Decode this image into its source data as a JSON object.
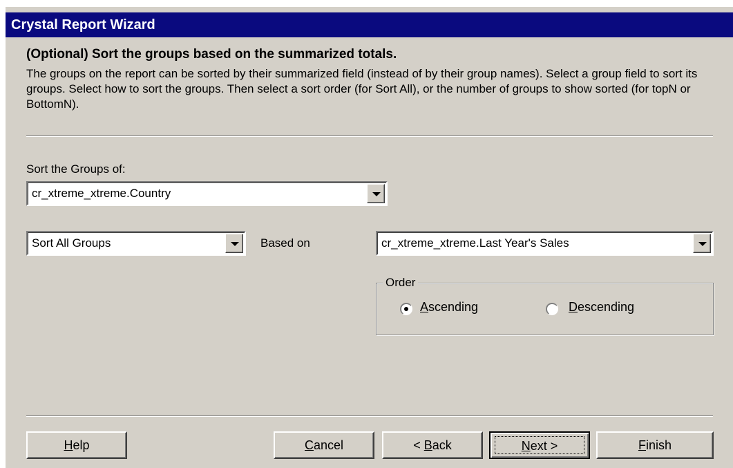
{
  "window": {
    "title": "Crystal Report Wizard"
  },
  "page": {
    "heading": "(Optional) Sort the groups based on the summarized totals.",
    "description": "The groups on the report can be sorted by their summarized field (instead of by their group names). Select a group field to sort its groups. Select  how to sort the groups. Then select a sort order (for Sort All), or the number of groups to show sorted (for topN or BottomN)."
  },
  "sort_groups": {
    "label": "Sort the Groups of:",
    "value": "cr_xtreme_xtreme.Country"
  },
  "sort_type": {
    "value": "Sort All Groups"
  },
  "based_on": {
    "label": "Based on",
    "value": "cr_xtreme_xtreme.Last Year's Sales"
  },
  "order": {
    "legend": "Order",
    "ascending": {
      "pre": "",
      "key": "A",
      "post": "scending",
      "checked": true
    },
    "descending": {
      "pre": "",
      "key": "D",
      "post": "escending",
      "checked": false
    }
  },
  "buttons": {
    "help": {
      "key": "H",
      "post": "elp"
    },
    "cancel": {
      "key": "C",
      "post": "ancel"
    },
    "back": {
      "pre": "< ",
      "key": "B",
      "post": "ack"
    },
    "next": {
      "pre": "",
      "key": "N",
      "post": "ext >"
    },
    "finish": {
      "key": "F",
      "post": "inish"
    }
  },
  "icons": {
    "dropdown": "chevron-down-icon",
    "radio_checked": "radio-checked-icon",
    "radio_unchecked": "radio-unchecked-icon"
  }
}
